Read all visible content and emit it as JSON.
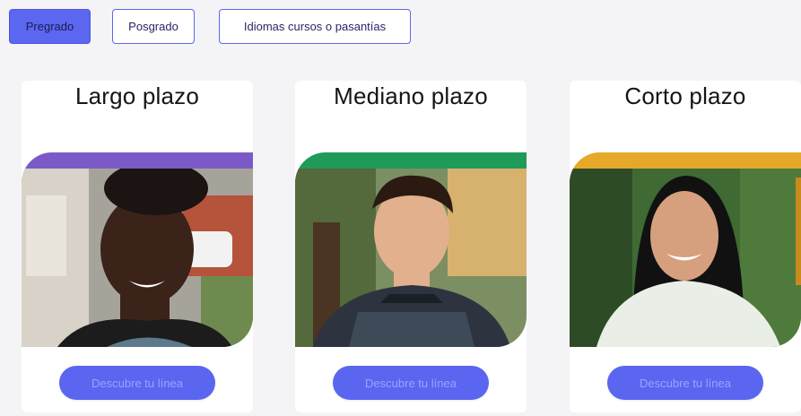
{
  "tabs": [
    {
      "label": "Pregrado",
      "active": true
    },
    {
      "label": "Posgrado",
      "active": false
    },
    {
      "label": "Idiomas cursos o pasantías",
      "active": false
    }
  ],
  "cards": [
    {
      "title": "Largo plazo",
      "button": "Descubre tu línea",
      "band_color": "#7b5ac8",
      "photo": "smiling-young-woman-photo"
    },
    {
      "title": "Mediano plazo",
      "button": "Descubre tu línea",
      "band_color": "#1f9a58",
      "photo": "young-man-sweater-photo"
    },
    {
      "title": "Corto plazo",
      "button": "Descubre tu línea",
      "band_color": "#e6a82a",
      "photo": "smiling-young-woman-long-hair-photo"
    }
  ],
  "colors": {
    "accent": "#5b67f1",
    "background": "#f4f4f6"
  }
}
